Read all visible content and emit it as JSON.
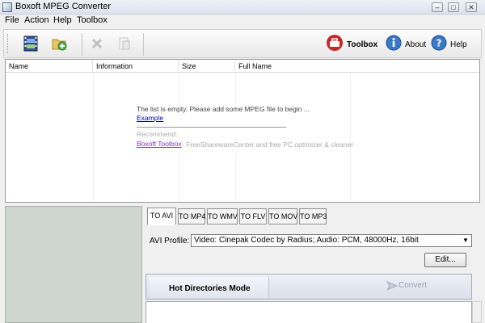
{
  "window": {
    "title": "Boxoft MPEG Converter",
    "minimize": "–",
    "maximize": "□",
    "close": "✕"
  },
  "menu": [
    "File",
    "Action",
    "Help",
    "Toolbox"
  ],
  "toolbar": {
    "buttons": [
      {
        "name": "add-files-button",
        "icon": "film-strip-icon"
      },
      {
        "name": "add-folder-button",
        "icon": "folder-add-icon"
      },
      {
        "name": "remove-button",
        "icon": "delete-icon"
      },
      {
        "name": "clear-button",
        "icon": "clear-list-icon"
      }
    ],
    "toolbox_label": "Toolbox",
    "about_label": "About",
    "help_label": "Help"
  },
  "file_list": {
    "columns": [
      "Name",
      "Information",
      "Size",
      "Full Name"
    ],
    "empty_message": "The list is empty. Please add some MPEG file to begin ...",
    "example_link": "Example",
    "recommend_label": "Recommend:",
    "toolbox_link": "Boxoft Toolbox",
    "toolbox_desc": "- FreeSharewareCenter and free PC optimizer & cleaner"
  },
  "format_tabs": [
    "TO AVI",
    "TO MP4",
    "TO WMV",
    "TO FLV",
    "TO MOV",
    "TO MP3"
  ],
  "active_tab": "TO AVI",
  "profile": {
    "label": "AVI Profile:",
    "value": "Video: Cinepak Codec by Radius; Audio: PCM, 48000Hz, 16bit",
    "edit_label": "Edit..."
  },
  "hot_directories": {
    "label": "Hot Directories Mode",
    "convert_label": "Convert"
  },
  "colors": {
    "left_panel": "#cfd6cf",
    "link": "#0000cc",
    "toolbox_link": "#8a2be2"
  }
}
